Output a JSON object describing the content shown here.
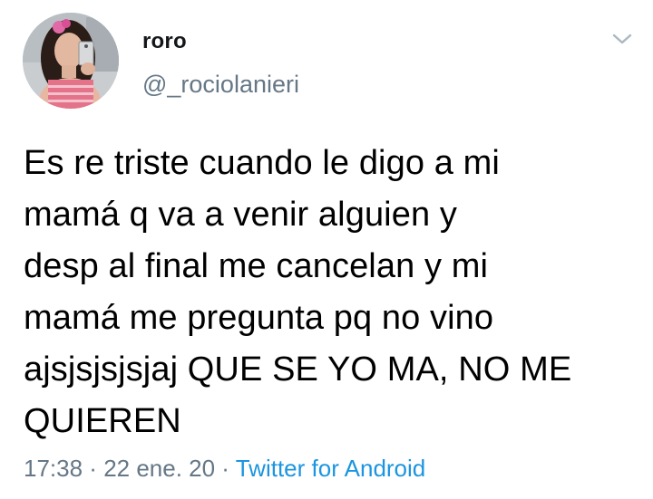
{
  "user": {
    "display_name": "roro",
    "handle": "@_rociolanieri"
  },
  "tweet": {
    "text": "Es re triste cuando le digo a mi\nmamá q va a venir alguien y\ndesp al final me cancelan y mi\nmamá me pregunta pq no vino\najsjsjsjsjaj QUE SE YO MA, NO ME\nQUIEREN"
  },
  "meta": {
    "time": "17:38",
    "separator": " · ",
    "date": "22 ene. 20",
    "source": "Twitter for Android"
  },
  "colors": {
    "secondary_text": "#657786",
    "link": "#1b95e0"
  },
  "icons": {
    "menu": "chevron-down-icon",
    "avatar": "profile-photo"
  }
}
